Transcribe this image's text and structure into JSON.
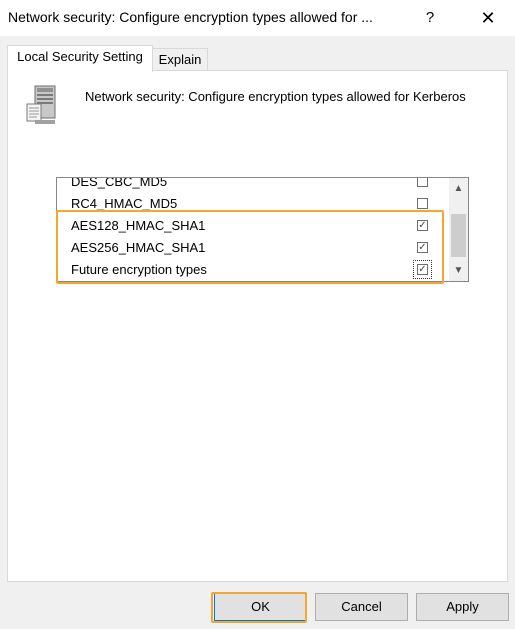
{
  "window": {
    "title": "Network security: Configure encryption types allowed for ...",
    "help_label": "?",
    "close_label": "✕"
  },
  "tabs": [
    {
      "label": "Local Security Setting",
      "active": true
    },
    {
      "label": "Explain",
      "active": false
    }
  ],
  "policy": {
    "icon": "server-icon",
    "title": "Network security: Configure encryption types allowed for Kerberos"
  },
  "encryption_list": {
    "items": [
      {
        "label": "DES_CBC_MD5",
        "checked": false
      },
      {
        "label": "RC4_HMAC_MD5",
        "checked": false
      },
      {
        "label": "AES128_HMAC_SHA1",
        "checked": true
      },
      {
        "label": "AES256_HMAC_SHA1",
        "checked": true
      },
      {
        "label": "Future encryption types",
        "checked": true
      }
    ],
    "scroll_up_icon": "▲",
    "scroll_down_icon": "▼"
  },
  "buttons": {
    "ok": "OK",
    "cancel": "Cancel",
    "apply": "Apply"
  },
  "colors": {
    "highlight": "#f0a830",
    "focus_border": "#0078d7"
  }
}
